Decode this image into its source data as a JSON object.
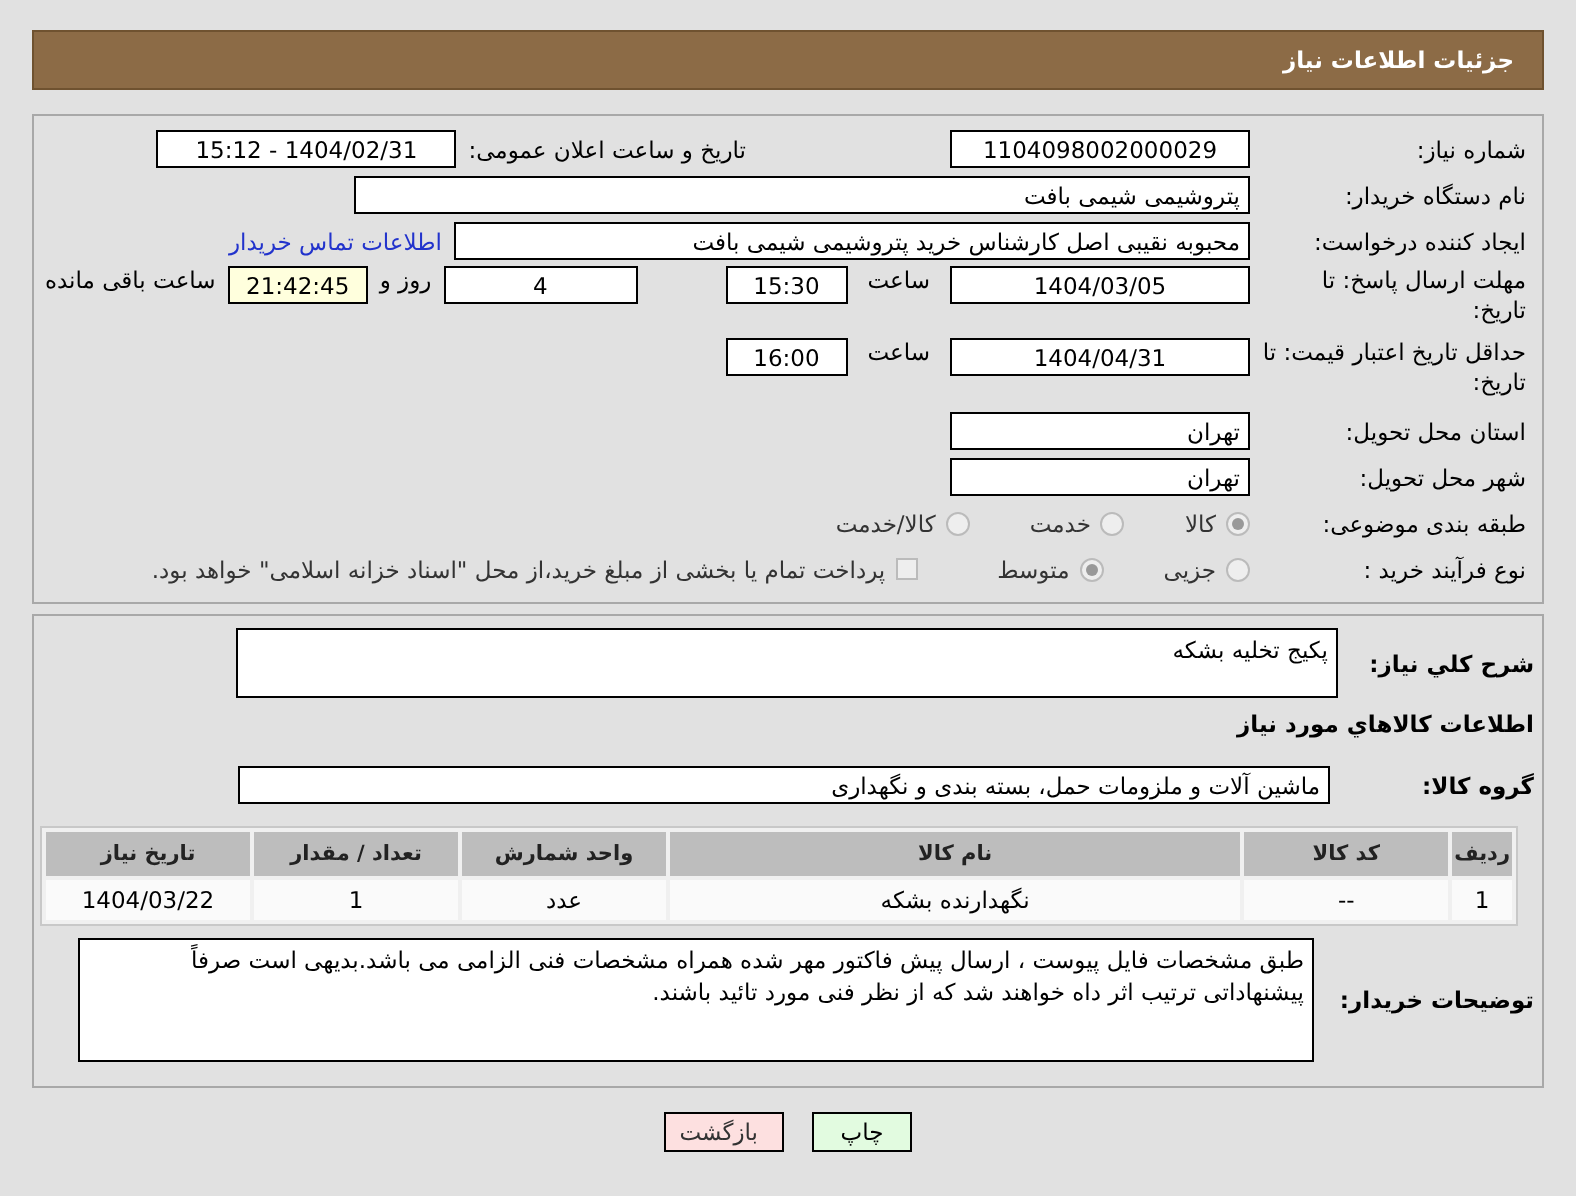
{
  "header": {
    "title": "جزئیات اطلاعات نیاز"
  },
  "need_number": {
    "label": "شماره نیاز:",
    "value": "1104098002000029"
  },
  "announce": {
    "label": "تاریخ و ساعت اعلان عمومی:",
    "value": "1404/02/31 - 15:12"
  },
  "buyer": {
    "label": "نام دستگاه خریدار:",
    "value": "پتروشیمی شیمی بافت"
  },
  "creator": {
    "label": "ایجاد کننده درخواست:",
    "value": "محبوبه نقیبی اصل کارشناس خرید پتروشیمی شیمی بافت",
    "link": "اطلاعات تماس خریدار"
  },
  "deadline": {
    "label": "مهلت ارسال پاسخ: تا تاریخ:",
    "date": "1404/03/05",
    "time_label": "ساعت",
    "time": "15:30",
    "days": "4",
    "days_label": "روز و",
    "remaining": "21:42:45",
    "remaining_label": "ساعت باقی مانده"
  },
  "validity": {
    "label": "حداقل تاریخ اعتبار قیمت: تا تاریخ:",
    "date": "1404/04/31",
    "time_label": "ساعت",
    "time": "16:00"
  },
  "province": {
    "label": "استان محل تحویل:",
    "value": "تهران"
  },
  "city": {
    "label": "شهر محل تحویل:",
    "value": "تهران"
  },
  "category": {
    "label": "طبقه بندی موضوعی:",
    "options": [
      {
        "label": "کالا",
        "selected": true
      },
      {
        "label": "خدمت",
        "selected": false
      },
      {
        "label": "کالا/خدمت",
        "selected": false
      }
    ]
  },
  "process": {
    "label": "نوع فرآیند خرید :",
    "options": [
      {
        "label": "جزیی",
        "selected": false
      },
      {
        "label": "متوسط",
        "selected": true
      }
    ],
    "checkbox": {
      "label": "پرداخت تمام یا بخشی از مبلغ خرید،از محل \"اسناد خزانه اسلامی\" خواهد بود.",
      "checked": false
    }
  },
  "description": {
    "label": "شرح کلي نياز:",
    "value": "پکیج تخلیه بشکه"
  },
  "goods_heading": "اطلاعات کالاهاي مورد نياز",
  "goods_group": {
    "label": "گروه کالا:",
    "value": "ماشین آلات و ملزومات حمل، بسته بندی و نگهداری"
  },
  "table": {
    "columns": [
      "ردیف",
      "کد کالا",
      "نام کالا",
      "واحد شمارش",
      "تعداد / مقدار",
      "تاریخ نیاز"
    ],
    "rows": [
      [
        "1",
        "--",
        "نگهدارنده بشکه",
        "عدد",
        "1",
        "1404/03/22"
      ]
    ]
  },
  "buyer_notes": {
    "label": "توضیحات خریدار:",
    "value": "طبق مشخصات فایل پیوست ، ارسال پیش فاکتور مهر شده همراه مشخصات فنی الزامی می باشد.بدیهی است صرفاً پیشنهاداتی ترتیب اثر داه خواهند شد که از نظر فنی مورد تائید باشند."
  },
  "buttons": [
    {
      "label": "چاپ",
      "kind": "print"
    },
    {
      "label": "بازگشت",
      "kind": "back"
    }
  ]
}
